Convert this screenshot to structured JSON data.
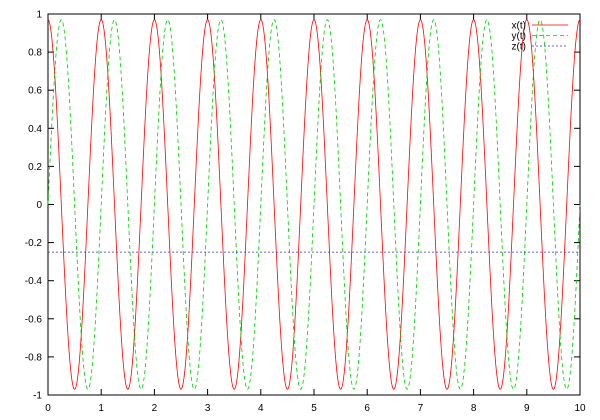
{
  "chart_data": {
    "type": "line",
    "title": "",
    "xlabel": "",
    "ylabel": "",
    "xlim": [
      0,
      10
    ],
    "ylim": [
      -1,
      1
    ],
    "xticks": [
      "0",
      "1",
      "2",
      "3",
      "4",
      "5",
      "6",
      "7",
      "8",
      "9",
      "10"
    ],
    "yticks": [
      "1",
      "0.8",
      "0.6",
      "0.4",
      "0.2",
      "0",
      "-0.2",
      "-0.4",
      "-0.6",
      "-0.8",
      "-1"
    ],
    "grid": false,
    "legend_position": "top-right",
    "series": [
      {
        "name": "x(t)",
        "color": "#ff0000",
        "style": "solid",
        "amplitude": 0.97,
        "period": 1.0,
        "phase": "cosine",
        "x": [
          0,
          0.5,
          1,
          1.5,
          2,
          2.5,
          3,
          3.5,
          4,
          4.5,
          5,
          5.5,
          6,
          6.5,
          7,
          7.5,
          8,
          8.5,
          9,
          9.5,
          10
        ],
        "y": [
          0.97,
          -0.97,
          0.97,
          -0.97,
          0.97,
          -0.97,
          0.97,
          -0.97,
          0.97,
          -0.97,
          0.97,
          -0.97,
          0.97,
          -0.97,
          0.97,
          -0.97,
          0.97,
          -0.97,
          0.97,
          -0.97,
          0.97
        ]
      },
      {
        "name": "y(t)",
        "color": "#00cc00",
        "style": "dashed",
        "amplitude": 0.97,
        "period": 1.0,
        "phase": "sine",
        "x": [
          0,
          0.25,
          0.75,
          1.25,
          1.75,
          2.25,
          2.75,
          3.25,
          3.75,
          4.25,
          4.75,
          5.25,
          5.75,
          6.25,
          6.75,
          7.25,
          7.75,
          8.25,
          8.75,
          9.25,
          9.75,
          10
        ],
        "y": [
          0,
          0.97,
          -0.97,
          0.97,
          -0.97,
          0.97,
          -0.97,
          0.97,
          -0.97,
          0.97,
          -0.97,
          0.97,
          -0.97,
          0.97,
          -0.97,
          0.97,
          -0.97,
          0.97,
          -0.97,
          0.97,
          -0.97,
          0
        ]
      },
      {
        "name": "z(t)",
        "color": "#3333cc",
        "style": "dotted",
        "x": [
          0,
          10
        ],
        "y": [
          -0.25,
          -0.25
        ]
      }
    ]
  }
}
